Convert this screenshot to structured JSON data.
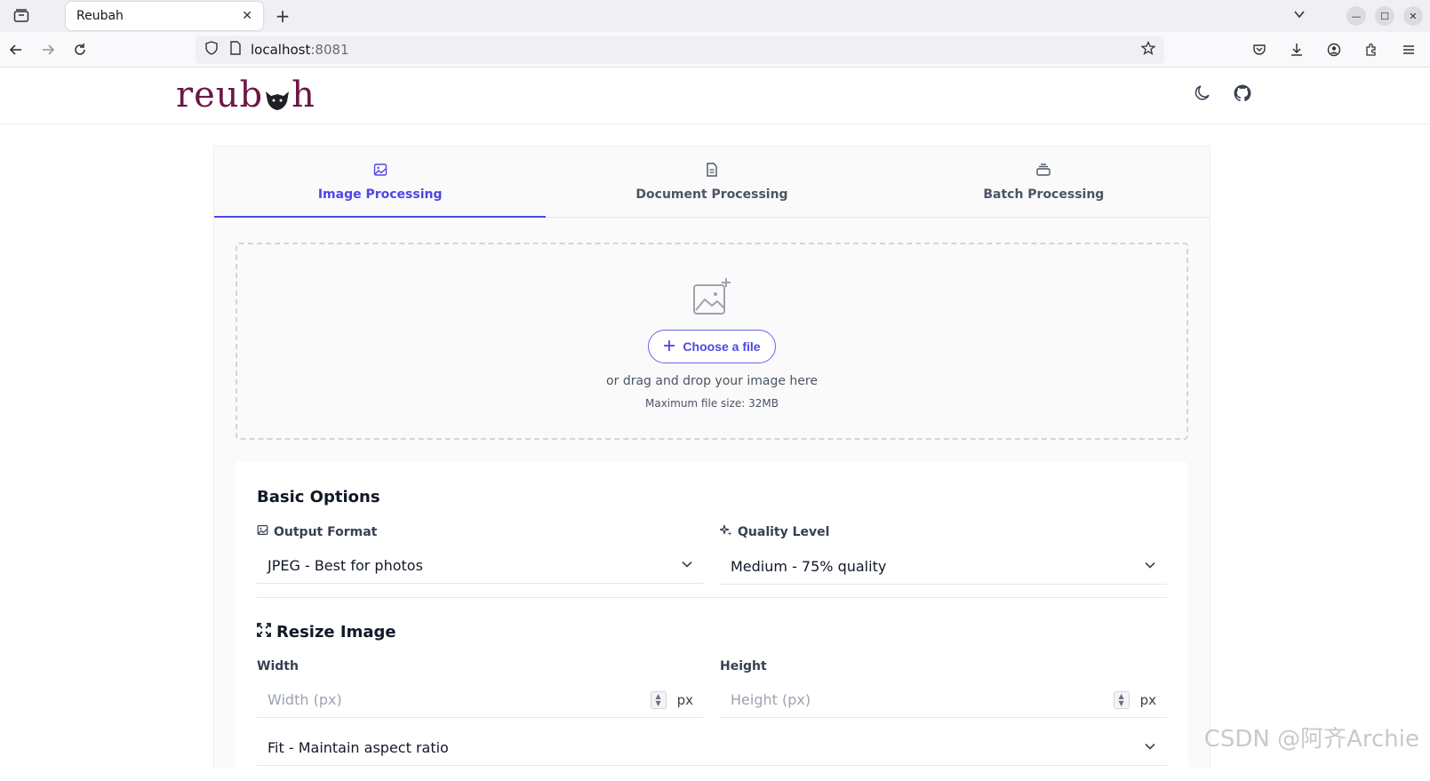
{
  "browser": {
    "tab_title": "Reubah",
    "url_host": "localhost",
    "url_port": ":8081"
  },
  "app": {
    "logo_text_left": "reub",
    "logo_text_right": "h"
  },
  "tabs": [
    {
      "label": "Image Processing",
      "icon": "image-icon",
      "active": true
    },
    {
      "label": "Document Processing",
      "icon": "document-icon",
      "active": false
    },
    {
      "label": "Batch Processing",
      "icon": "stack-icon",
      "active": false
    }
  ],
  "dropzone": {
    "button_label": "Choose a file",
    "drag_text": "or drag and drop your image here",
    "max_size_text": "Maximum file size: 32MB"
  },
  "basic_options": {
    "title": "Basic Options",
    "output_format_label": "Output Format",
    "output_format_value": "JPEG - Best for photos",
    "quality_label": "Quality Level",
    "quality_value": "Medium - 75% quality"
  },
  "resize": {
    "title": "Resize Image",
    "width_label": "Width",
    "width_placeholder": "Width (px)",
    "height_label": "Height",
    "height_placeholder": "Height (px)",
    "unit": "px",
    "fit_value": "Fit - Maintain aspect ratio"
  },
  "watermark": "CSDN @阿齐Archie",
  "colors": {
    "accent": "#4f46e5",
    "logo": "#6b1747"
  }
}
